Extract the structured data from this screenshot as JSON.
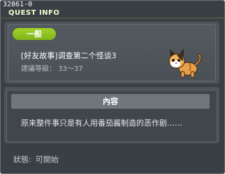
{
  "window": {
    "quest_id": "32861-0",
    "title": "QUEST INFO"
  },
  "quest": {
    "category_badge": "一般",
    "name": "[好友故事]调查第二个怪谈3",
    "level_label": "建議等級",
    "level_separator": "：",
    "level_range": "33～37",
    "npc_icon": "cat-monster-icon"
  },
  "content": {
    "header": "內容",
    "text": "原来整件事只是有人用番茄酱制造的恶作剧……"
  },
  "status": {
    "label": "狀態:",
    "value": "可開始"
  },
  "colors": {
    "window_bg": "#3a3f45",
    "title_text": "#f2ffd0",
    "badge_green": "#8bc21f",
    "header_bar": "#6f767c"
  }
}
